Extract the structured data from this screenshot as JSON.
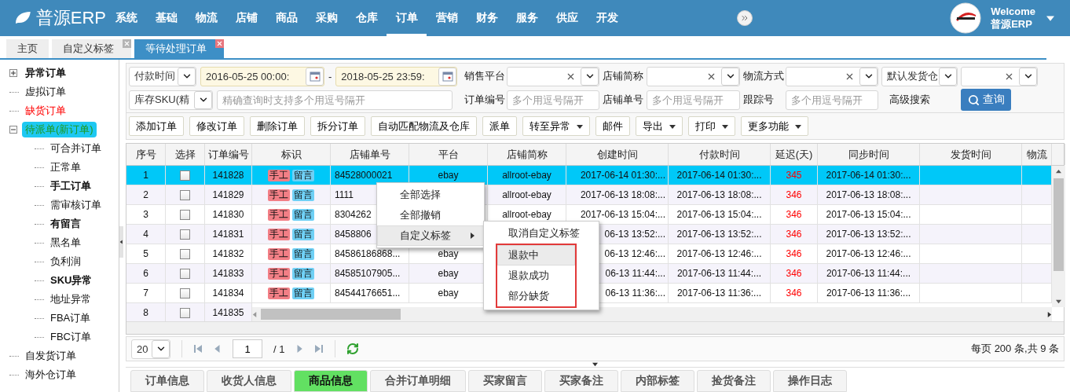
{
  "app": {
    "logo": "普源ERP",
    "nav": [
      {
        "label": "系统",
        "selected": false
      },
      {
        "label": "基础",
        "selected": false
      },
      {
        "label": "物流",
        "selected": false
      },
      {
        "label": "店铺",
        "selected": false
      },
      {
        "label": "商品",
        "selected": false
      },
      {
        "label": "采购",
        "selected": false
      },
      {
        "label": "仓库",
        "selected": false
      },
      {
        "label": "订单",
        "selected": true
      },
      {
        "label": "营销",
        "selected": false
      },
      {
        "label": "财务",
        "selected": false
      },
      {
        "label": "服务",
        "selected": false
      },
      {
        "label": "供应",
        "selected": false
      },
      {
        "label": "开发",
        "selected": false
      }
    ],
    "user": {
      "greeting": "Welcome",
      "name": "普源ERP"
    }
  },
  "page_tabs": [
    {
      "label": "主页",
      "selected": false,
      "closable": false
    },
    {
      "label": "自定义标签",
      "selected": false,
      "closable": true
    },
    {
      "label": "等待处理订单",
      "selected": true,
      "closable": true
    }
  ],
  "sidebar": {
    "items": [
      {
        "label": "异常订单",
        "kind": "heading",
        "selected": false,
        "expanded": false
      },
      {
        "label": "虚拟订单",
        "kind": "plain",
        "selected": false
      },
      {
        "label": "缺货订单",
        "kind": "warning",
        "selected": false
      },
      {
        "label": "待派单(新订单)",
        "kind": "plain",
        "selected": true,
        "expanded": true,
        "children": [
          {
            "label": "可合并订单",
            "kind": "plain",
            "selected": false
          },
          {
            "label": "正常单",
            "kind": "plain",
            "selected": false
          },
          {
            "label": "手工订单",
            "kind": "heading",
            "selected": false
          },
          {
            "label": "需审核订单",
            "kind": "plain",
            "selected": false
          },
          {
            "label": "有留言",
            "kind": "heading",
            "selected": false
          },
          {
            "label": "黑名单",
            "kind": "plain",
            "selected": false
          },
          {
            "label": "负利润",
            "kind": "plain",
            "selected": false
          },
          {
            "label": "SKU异常",
            "kind": "heading",
            "selected": false
          },
          {
            "label": "地址异常",
            "kind": "plain",
            "selected": false
          },
          {
            "label": "FBA订单",
            "kind": "plain",
            "selected": false
          },
          {
            "label": "FBC订单",
            "kind": "plain",
            "selected": false
          }
        ]
      },
      {
        "label": "自发货订单",
        "kind": "plain",
        "selected": false
      },
      {
        "label": "海外仓订单",
        "kind": "plain",
        "selected": false
      }
    ]
  },
  "filters": {
    "rows": [
      {
        "lead": [
          {
            "kind": "select",
            "value": "付款时间"
          },
          {
            "kind": "date",
            "value": "2016-05-25 00:00:"
          },
          {
            "kind": "dash",
            "text": "-"
          },
          {
            "kind": "date",
            "value": "2018-05-25 23:59:"
          }
        ],
        "fields": [
          {
            "kind": "label",
            "text": "销售平台"
          },
          {
            "kind": "combo"
          },
          {
            "kind": "label",
            "text": "店铺简称"
          },
          {
            "kind": "combo"
          },
          {
            "kind": "label",
            "text": "物流方式"
          },
          {
            "kind": "combo"
          },
          {
            "kind": "select",
            "value": "默认发货仓"
          },
          {
            "kind": "combo"
          }
        ]
      },
      {
        "lead": [
          {
            "kind": "select",
            "value": "库存SKU(精"
          },
          {
            "kind": "input",
            "placeholder": "精确查询时支持多个用逗号隔开"
          }
        ],
        "fields": [
          {
            "kind": "label",
            "text": "订单编号"
          },
          {
            "kind": "input",
            "placeholder": "多个用逗号隔开"
          },
          {
            "kind": "label",
            "text": "店铺单号"
          },
          {
            "kind": "input",
            "placeholder": "多个用逗号隔开"
          },
          {
            "kind": "label",
            "text": "跟踪号"
          },
          {
            "kind": "input",
            "placeholder": "多个用逗号隔开"
          },
          {
            "kind": "link",
            "text": "高级搜索"
          },
          {
            "kind": "button",
            "text": "查询"
          }
        ]
      }
    ]
  },
  "toolbar": [
    {
      "label": "添加订单",
      "has_menu": false
    },
    {
      "label": "修改订单",
      "has_menu": false
    },
    {
      "label": "删除订单",
      "has_menu": false
    },
    {
      "label": "拆分订单",
      "has_menu": false
    },
    {
      "label": "自动匹配物流及仓库",
      "has_menu": false
    },
    {
      "label": "派单",
      "has_menu": false
    },
    {
      "label": "转至异常",
      "has_menu": true
    },
    {
      "label": "邮件",
      "has_menu": false
    },
    {
      "label": "导出",
      "has_menu": true
    },
    {
      "label": "打印",
      "has_menu": true
    },
    {
      "label": "更多功能",
      "has_menu": true
    }
  ],
  "table": {
    "columns": [
      "序号",
      "选择",
      "订单编号",
      "标识",
      "店铺单号",
      "平台",
      "店铺简称",
      "创建时间",
      "付款时间",
      "延迟(天)",
      "同步时间",
      "发货时间",
      "物流"
    ],
    "rows": [
      {
        "selected": true,
        "checked": false,
        "no": "1",
        "order_no": "141828",
        "tags": [
          {
            "text": "手工",
            "color": "#f27f86"
          },
          {
            "text": "留言",
            "color": "#6fd0f5"
          }
        ],
        "store_order_no": "84528000021",
        "platform": "ebay",
        "store_name": "allroot-ebay",
        "created": "2017-06-14 01:30:...",
        "paid": "2017-06-14 01:30:...",
        "delay": "345",
        "synced": "2017-06-14 01:30:..."
      },
      {
        "selected": false,
        "checked": false,
        "no": "2",
        "order_no": "141829",
        "tags": [
          {
            "text": "手工",
            "color": "#f27f86"
          },
          {
            "text": "留言",
            "color": "#6fd0f5"
          }
        ],
        "store_order_no": "1111",
        "store_name": "allroot-ebay",
        "created": "2017-06-13 18:08:...",
        "paid": "2017-06-13 18:08:...",
        "delay": "346",
        "synced": "2017-06-13 18:08:..."
      },
      {
        "selected": false,
        "checked": false,
        "no": "3",
        "order_no": "141830",
        "tags": [
          {
            "text": "手工",
            "color": "#f27f86"
          },
          {
            "text": "留言",
            "color": "#6fd0f5"
          }
        ],
        "store_order_no": "8304262",
        "store_name": "allroot-ebay",
        "created": "2017-06-13 15:04:...",
        "paid": "2017-06-13 15:04:...",
        "delay": "346",
        "synced": "2017-06-13 15:04:..."
      },
      {
        "selected": false,
        "checked": false,
        "no": "4",
        "order_no": "141831",
        "tags": [
          {
            "text": "手工",
            "color": "#f27f86"
          },
          {
            "text": "留言",
            "color": "#6fd0f5"
          }
        ],
        "store_order_no": "8458806",
        "created": "06-13 13:52:...",
        "paid": "2017-06-13 13:52:...",
        "delay": "346",
        "synced": "2017-06-13 13:52:..."
      },
      {
        "selected": false,
        "checked": false,
        "no": "5",
        "order_no": "141832",
        "tags": [
          {
            "text": "手工",
            "color": "#f27f86"
          },
          {
            "text": "留言",
            "color": "#6fd0f5"
          }
        ],
        "store_order_no": "84586186868...",
        "platform": "ebay",
        "created": "06-13 12:46:...",
        "paid": "2017-06-13 12:46:...",
        "delay": "346",
        "synced": "2017-06-13 12:46:..."
      },
      {
        "selected": false,
        "checked": false,
        "no": "6",
        "order_no": "141833",
        "tags": [
          {
            "text": "手工",
            "color": "#f27f86"
          },
          {
            "text": "留言",
            "color": "#6fd0f5"
          }
        ],
        "store_order_no": "84585107905...",
        "platform": "ebay",
        "created": "06-13 11:44:...",
        "paid": "2017-06-13 11:44:...",
        "delay": "346",
        "synced": "2017-06-13 11:44:..."
      },
      {
        "selected": false,
        "checked": false,
        "no": "7",
        "order_no": "141834",
        "tags": [
          {
            "text": "手工",
            "color": "#f27f86"
          },
          {
            "text": "留言",
            "color": "#6fd0f5"
          }
        ],
        "store_order_no": "84544176651...",
        "platform": "ebay",
        "created": "06-13 11:36:...",
        "paid": "2017-06-13 11:36:...",
        "delay": "346",
        "synced": "2017-06-13 11:36:..."
      },
      {
        "selected": false,
        "checked": false,
        "no": "8",
        "order_no": "141835"
      }
    ]
  },
  "context_menu": {
    "items": [
      {
        "label": "全部选择",
        "highlighted": false
      },
      {
        "label": "全部撤销",
        "highlighted": false
      },
      {
        "label": "自定义标签",
        "highlighted": true,
        "children": [
          {
            "label": "取消自定义标签",
            "highlighted": false,
            "boxed": false
          },
          {
            "label": "退款中",
            "highlighted": true,
            "boxed": true
          },
          {
            "label": "退款成功",
            "highlighted": false,
            "boxed": true
          },
          {
            "label": "部分缺货",
            "highlighted": false,
            "boxed": true
          }
        ]
      }
    ]
  },
  "pager": {
    "page_size": "20",
    "page": "1",
    "total_pages": "/ 1",
    "summary": "每页 200 条,共 9 条"
  },
  "detail_tabs": [
    {
      "label": "订单信息",
      "selected": false
    },
    {
      "label": "收货人信息",
      "selected": false
    },
    {
      "label": "商品信息",
      "selected": true
    },
    {
      "label": "合并订单明细",
      "selected": false
    },
    {
      "label": "买家留言",
      "selected": false
    },
    {
      "label": "买家备注",
      "selected": false
    },
    {
      "label": "内部标签",
      "selected": false
    },
    {
      "label": "捡货备注",
      "selected": false
    },
    {
      "label": "操作日志",
      "selected": false
    }
  ]
}
